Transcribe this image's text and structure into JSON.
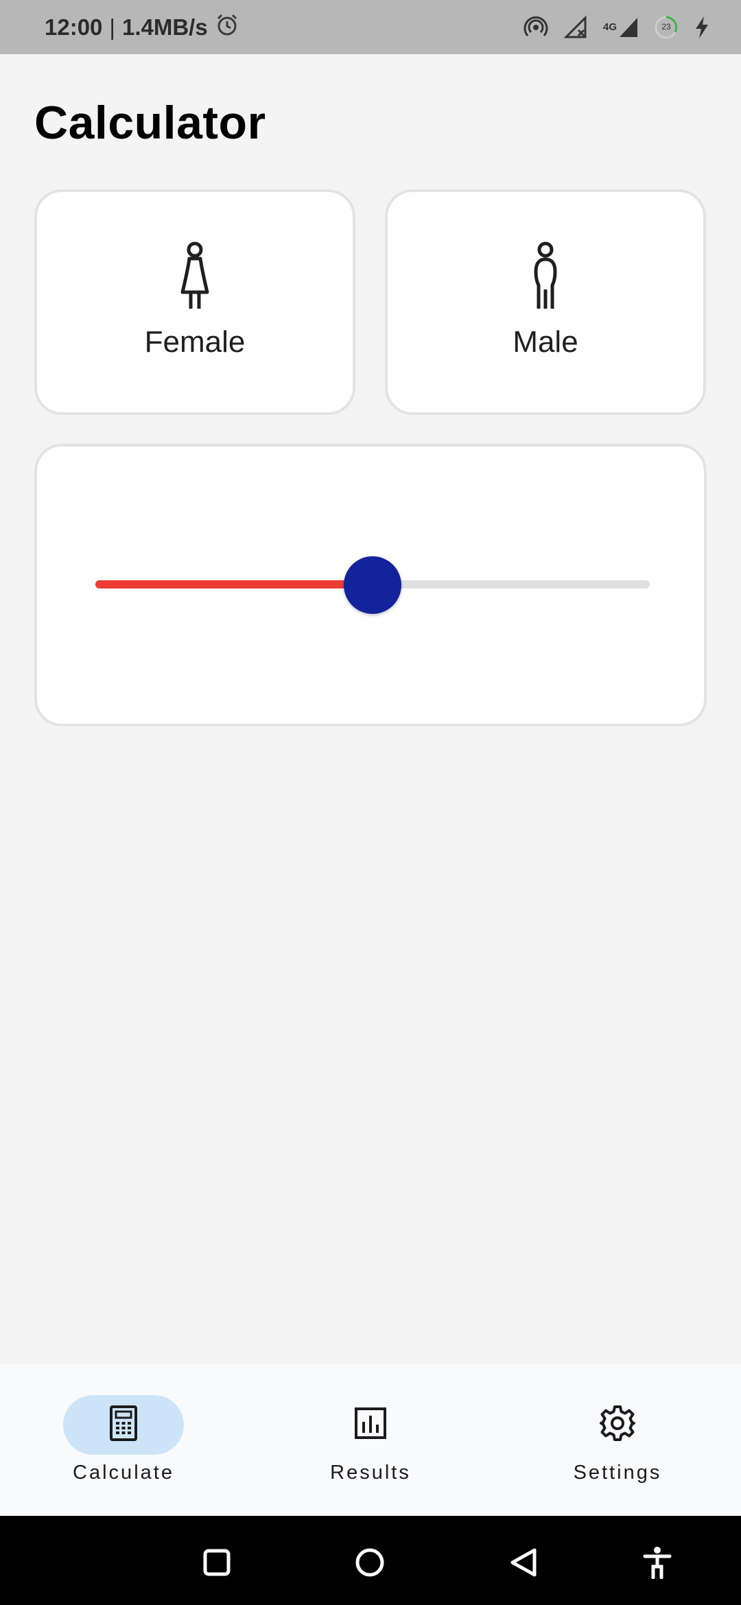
{
  "status_bar": {
    "time": "12:00",
    "separator": "|",
    "speed": "1.4MB/s",
    "network": "4G",
    "battery": "23",
    "icons": [
      "alarm-icon",
      "hotspot-icon",
      "no-signal-icon",
      "signal-icon",
      "battery-icon",
      "charging-icon"
    ]
  },
  "page": {
    "title": "Calculator"
  },
  "gender": {
    "female_label": "Female",
    "male_label": "Male"
  },
  "slider": {
    "fraction": 0.5,
    "fill_color": "#ec3d34",
    "thumb_color": "#13239c"
  },
  "nav": {
    "items": [
      {
        "label": "Calculate",
        "icon": "calculator-icon",
        "active": true
      },
      {
        "label": "Results",
        "icon": "bar-chart-icon",
        "active": false
      },
      {
        "label": "Settings",
        "icon": "gear-icon",
        "active": false
      }
    ]
  },
  "system_nav": {
    "icons": [
      "recents-icon",
      "home-icon",
      "back-icon",
      "accessibility-icon"
    ]
  },
  "colors": {
    "accent": "#13239c",
    "active_pill": "#cde4f8",
    "background": "#f4f4f5"
  }
}
